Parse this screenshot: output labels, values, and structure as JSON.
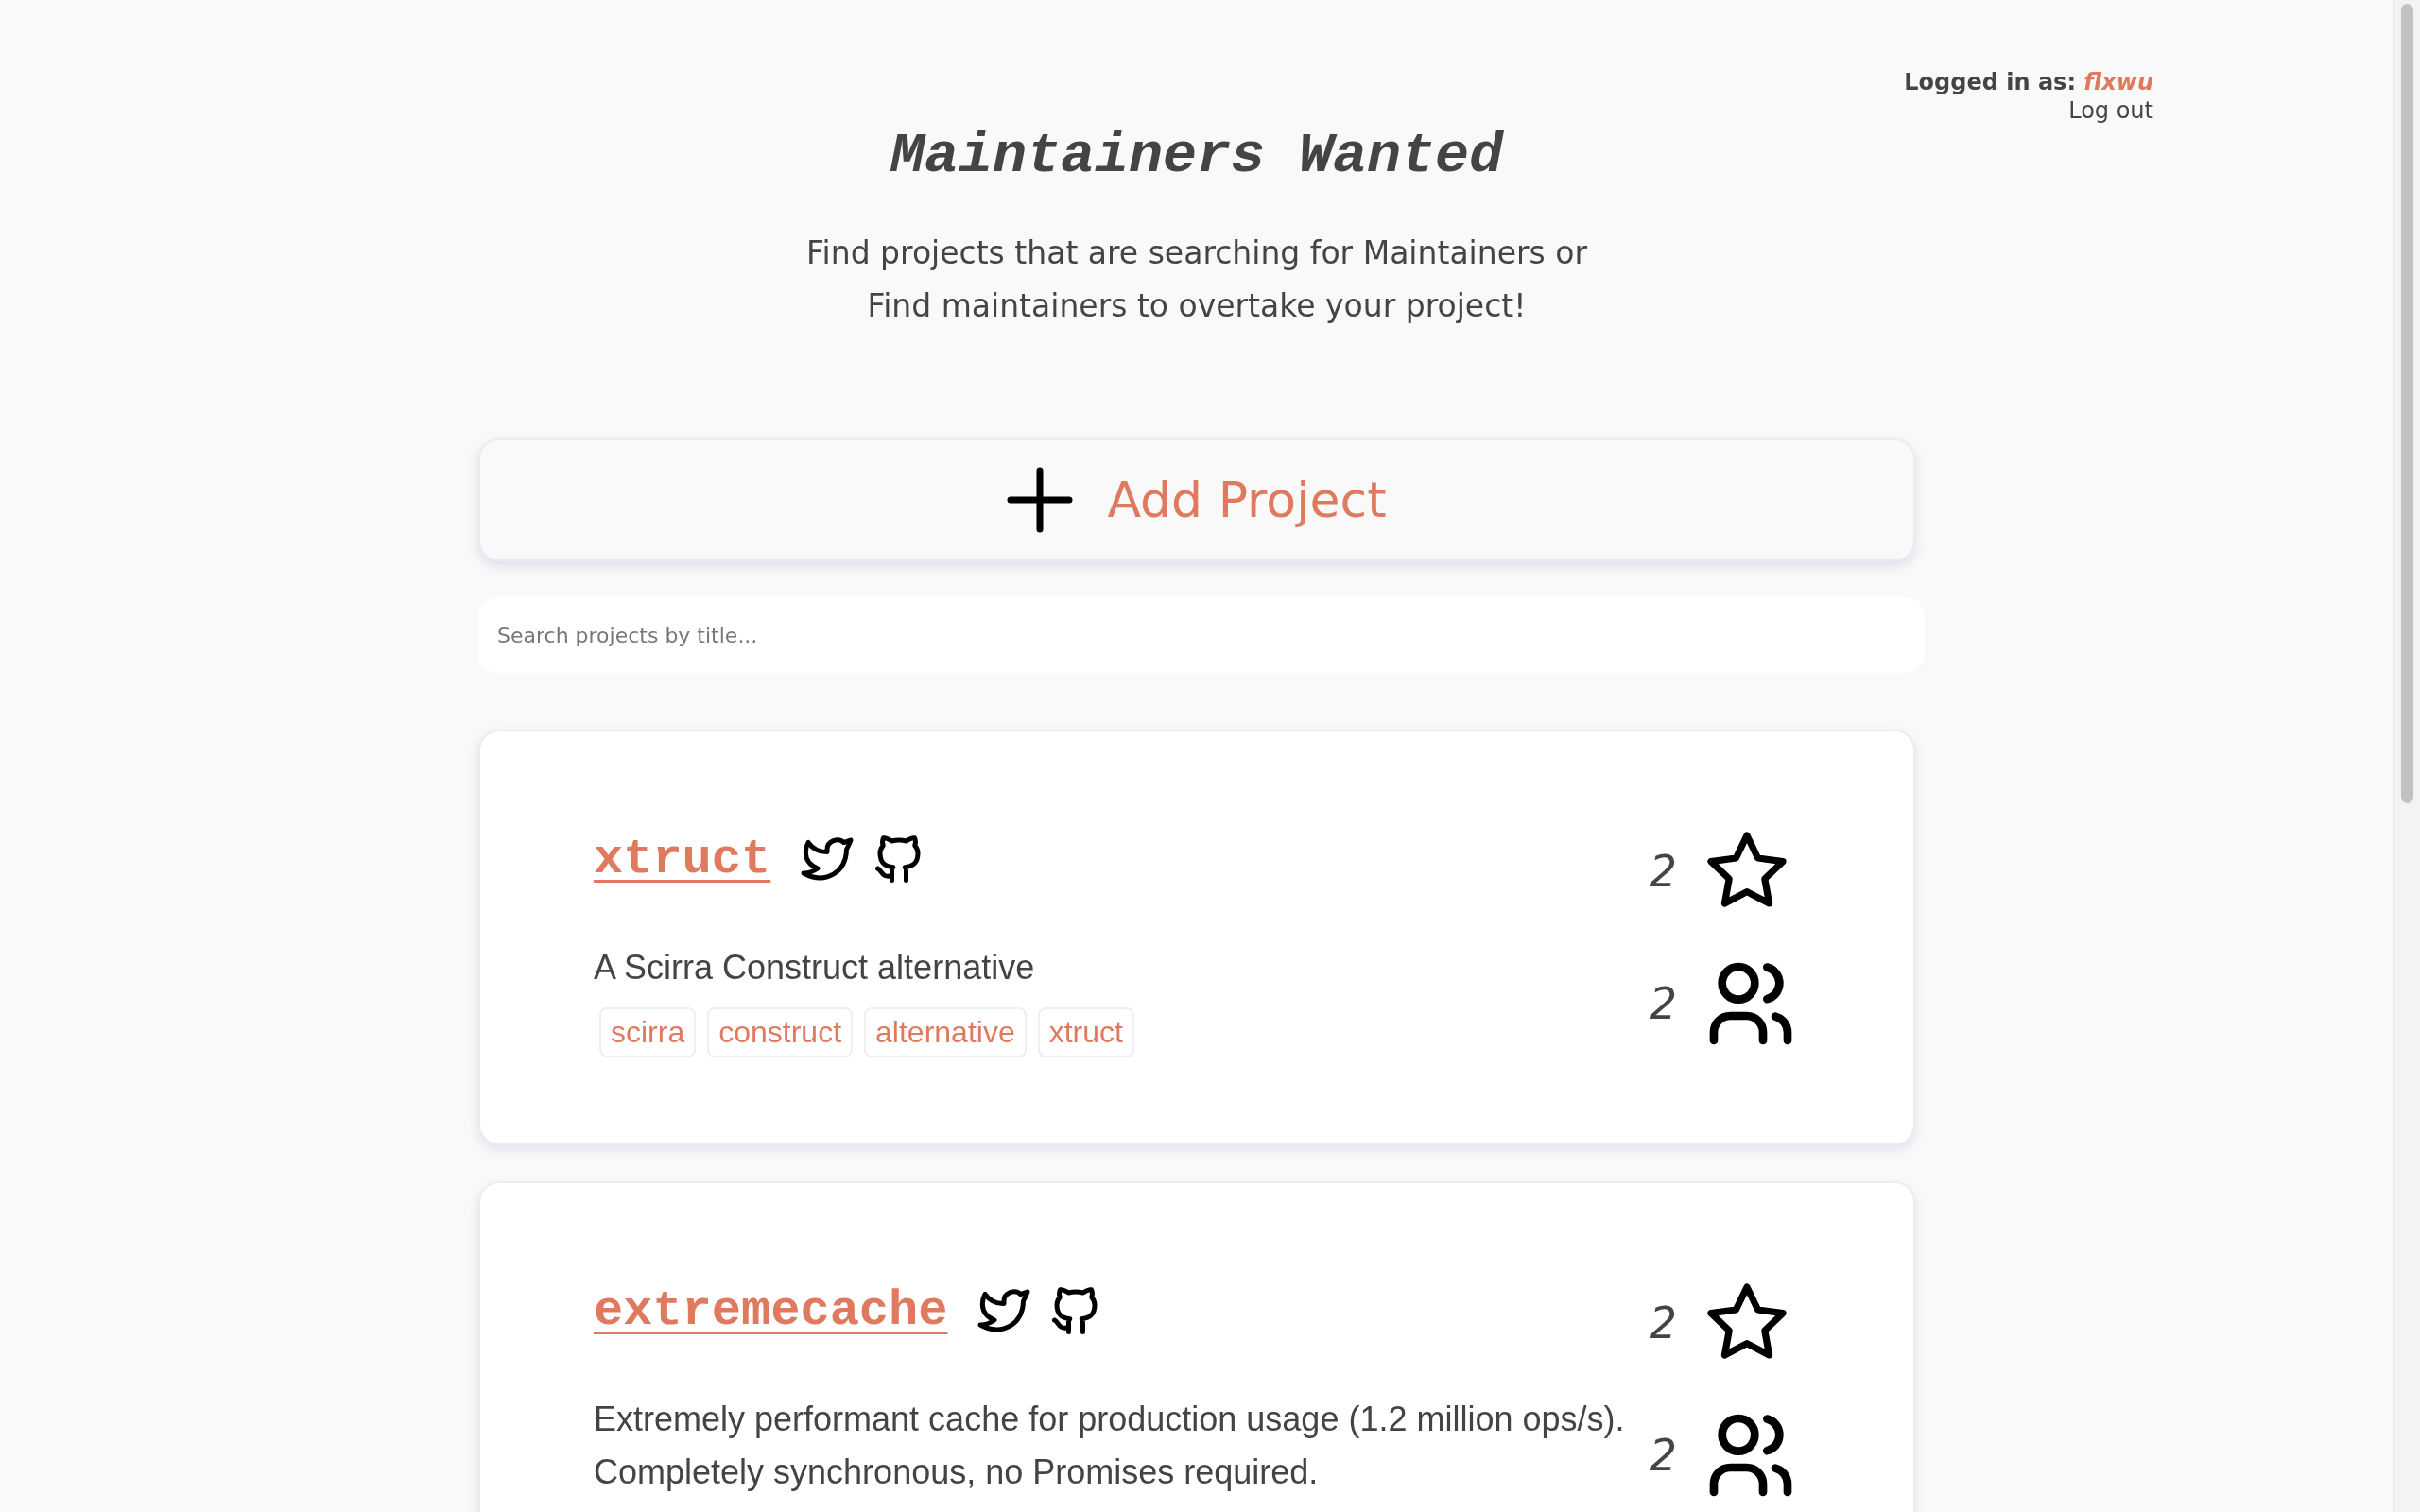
{
  "user": {
    "label": "Logged in as:",
    "name": "flxwu",
    "logout": "Log out"
  },
  "title": "Maintainers Wanted",
  "subtitle": [
    "Find projects that are searching for Maintainers or",
    "Find maintainers to overtake your project!"
  ],
  "add_button": "Add Project",
  "search": {
    "placeholder": "Search projects by title..."
  },
  "projects": [
    {
      "title": "xtruct",
      "links": [
        {
          "kind": "twitter"
        },
        {
          "kind": "github"
        }
      ],
      "description": [
        "A Scirra Construct alternative"
      ],
      "tags": [
        "scirra",
        "construct",
        "alternative",
        "xtruct"
      ],
      "star_count": "2",
      "maintainer_count": "2"
    },
    {
      "title": "extremecache",
      "links": [
        {
          "kind": "twitter"
        },
        {
          "kind": "github"
        }
      ],
      "description": [
        "Extremely performant cache for production usage (1.2 million ops/s).",
        "Completely synchronous, no Promises required."
      ],
      "star_count": "2",
      "maintainer_count": "2"
    }
  ]
}
